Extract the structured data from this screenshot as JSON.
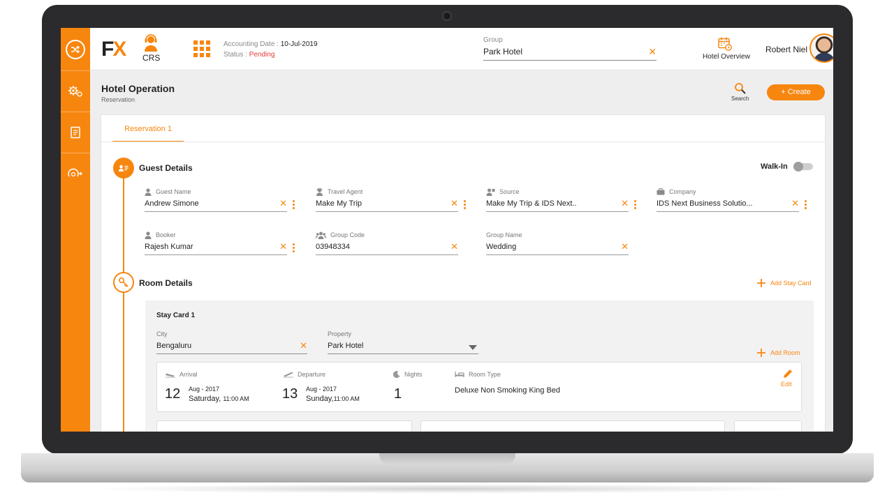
{
  "app": {
    "brand": "FX",
    "module": "CRS",
    "accounting_date_label": "Accounting Date :",
    "accounting_date": "10-Jul-2019",
    "status_label": "Status :",
    "status": "Pending",
    "group_label": "Group",
    "group_value": "Park Hotel",
    "hotel_overview_label": "Hotel Overview",
    "user_name": "Robert Niel"
  },
  "page": {
    "title": "Hotel Operation",
    "subtitle": "Reservation",
    "search_label": "Search",
    "create_label": "+ Create",
    "tab": "Reservation 1"
  },
  "guest": {
    "title": "Guest Details",
    "walk_in_label": "Walk-In",
    "fields": [
      {
        "label": "Guest Name",
        "value": "Andrew Simone"
      },
      {
        "label": "Travel Agent",
        "value": "Make My Trip"
      },
      {
        "label": "Source",
        "value": "Make My Trip & IDS Next.."
      },
      {
        "label": "Company",
        "value": "IDS Next Business Solutio..."
      },
      {
        "label": "Booker",
        "value": "Rajesh Kumar"
      },
      {
        "label": "Group Code",
        "value": "03948334"
      },
      {
        "label": "Group Name",
        "value": "Wedding"
      }
    ]
  },
  "room": {
    "title": "Room Details",
    "add_stay_card_label": "Add Stay Card",
    "stay_card_title": "Stay Card 1",
    "city_label": "City",
    "city_value": "Bengaluru",
    "property_label": "Property",
    "property_value": "Park Hotel",
    "add_room_label": "Add Room",
    "arrival_label": "Arrival",
    "arrival_day": "12",
    "arrival_month": "Aug - 2017",
    "arrival_weekday": "Saturday,",
    "arrival_time": "11:00 AM",
    "departure_label": "Departure",
    "departure_day": "13",
    "departure_month": "Aug - 2017",
    "departure_weekday": "Sunday,",
    "departure_time": "11:00 AM",
    "nights_label": "Nights",
    "nights_value": "1",
    "room_type_label": "Room Type",
    "room_type_value": "Deluxe Non Smoking King Bed",
    "edit_label": "Edit"
  },
  "colors": {
    "accent": "#f7860f",
    "status_pending": "#e53935"
  },
  "icons": {
    "rail": [
      "shuffle-icon",
      "settings-icon",
      "report-icon",
      "dashboard-icon"
    ],
    "topbar": [
      "agent-headset-icon",
      "apps-grid-icon",
      "calendar-icon",
      "chevron-down-icon"
    ],
    "fields": [
      "person-icon",
      "agent-icon",
      "source-icon",
      "briefcase-icon",
      "booker-icon",
      "group-icon"
    ]
  }
}
